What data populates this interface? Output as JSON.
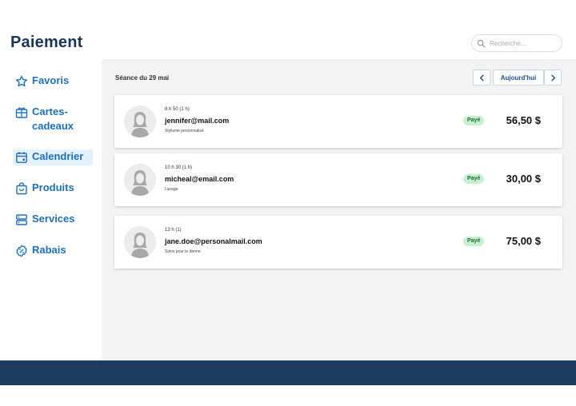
{
  "header": {
    "title": "Paiement",
    "search_placeholder": "Recherche..."
  },
  "sidebar": {
    "items": [
      {
        "label": "Favoris",
        "icon": "star-icon",
        "active": false
      },
      {
        "label": "Cartes-\ncadeaux",
        "icon": "gift-card-icon",
        "active": false
      },
      {
        "label": "Calendrier",
        "icon": "calendar-icon",
        "active": true
      },
      {
        "label": "Produits",
        "icon": "shopping-bag-icon",
        "active": false
      },
      {
        "label": "Services",
        "icon": "server-icon",
        "active": false
      },
      {
        "label": "Rabais",
        "icon": "discount-icon",
        "active": false
      }
    ]
  },
  "main": {
    "session_title": "Séance du 29 mai",
    "today_label": "Aujourd'hui",
    "appointments": [
      {
        "time": "8 h 50 (1 h)",
        "email": "jennifer@mail.com",
        "service": "Stylisme personnalisé",
        "status": "Payé",
        "amount": "56,50 $"
      },
      {
        "time": "10 h 30 (1 h)",
        "email": "micheal@email.com",
        "service": "Lavage",
        "status": "Payé",
        "amount": "30,00 $"
      },
      {
        "time": "13 h (1)",
        "email": "jane.doe@personalmail.com",
        "service": "Soins pour le derme",
        "status": "Payé",
        "amount": "75,00 $"
      }
    ]
  },
  "colors": {
    "brand_dark": "#1c3557",
    "nav_blue": "#1f6fb5",
    "active_bg": "#e2f1fb",
    "paid_badge": "#c7efd0",
    "footer": "#1c3c60"
  }
}
